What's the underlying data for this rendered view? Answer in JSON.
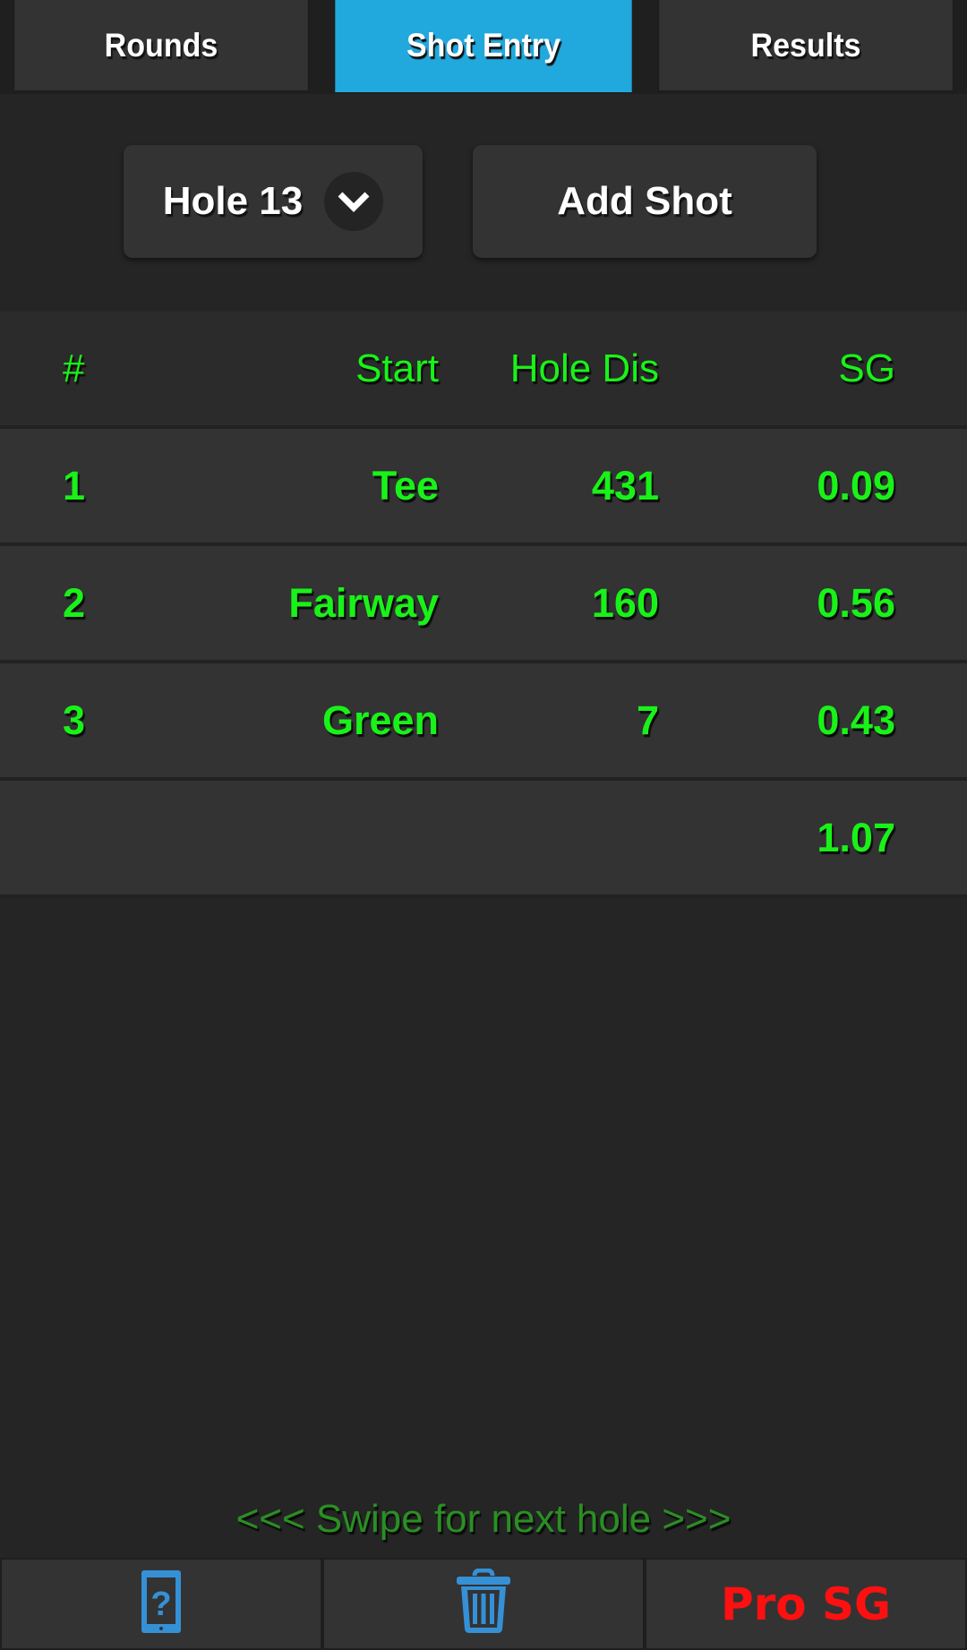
{
  "tabs": [
    {
      "label": "Rounds",
      "active": false
    },
    {
      "label": "Shot Entry",
      "active": true
    },
    {
      "label": "Results",
      "active": false
    }
  ],
  "controls": {
    "hole_select": {
      "selected": "Hole 13",
      "icon": "chevron-down-icon"
    },
    "add_shot_label": "Add Shot"
  },
  "table": {
    "headers": {
      "num": "#",
      "start": "Start",
      "hole_dis": "Hole Dis",
      "sg": "SG"
    },
    "rows": [
      {
        "num": "1",
        "start": "Tee",
        "hole_dis": "431",
        "sg": "0.09"
      },
      {
        "num": "2",
        "start": "Fairway",
        "hole_dis": "160",
        "sg": "0.56"
      },
      {
        "num": "3",
        "start": "Green",
        "hole_dis": "7",
        "sg": "0.43"
      }
    ],
    "total_sg": "1.07"
  },
  "swipe_hint": "<<< Swipe for next hole >>>",
  "bottom_bar": {
    "help_icon": "phone-help-icon",
    "delete_icon": "trash-icon",
    "pro_label": "Pro SG"
  },
  "colors": {
    "accent": "#21a9dd",
    "text_green": "#19f219",
    "hint_green": "#2a8f23",
    "pro_red": "#ff1010",
    "icon_blue": "#3590d6"
  }
}
